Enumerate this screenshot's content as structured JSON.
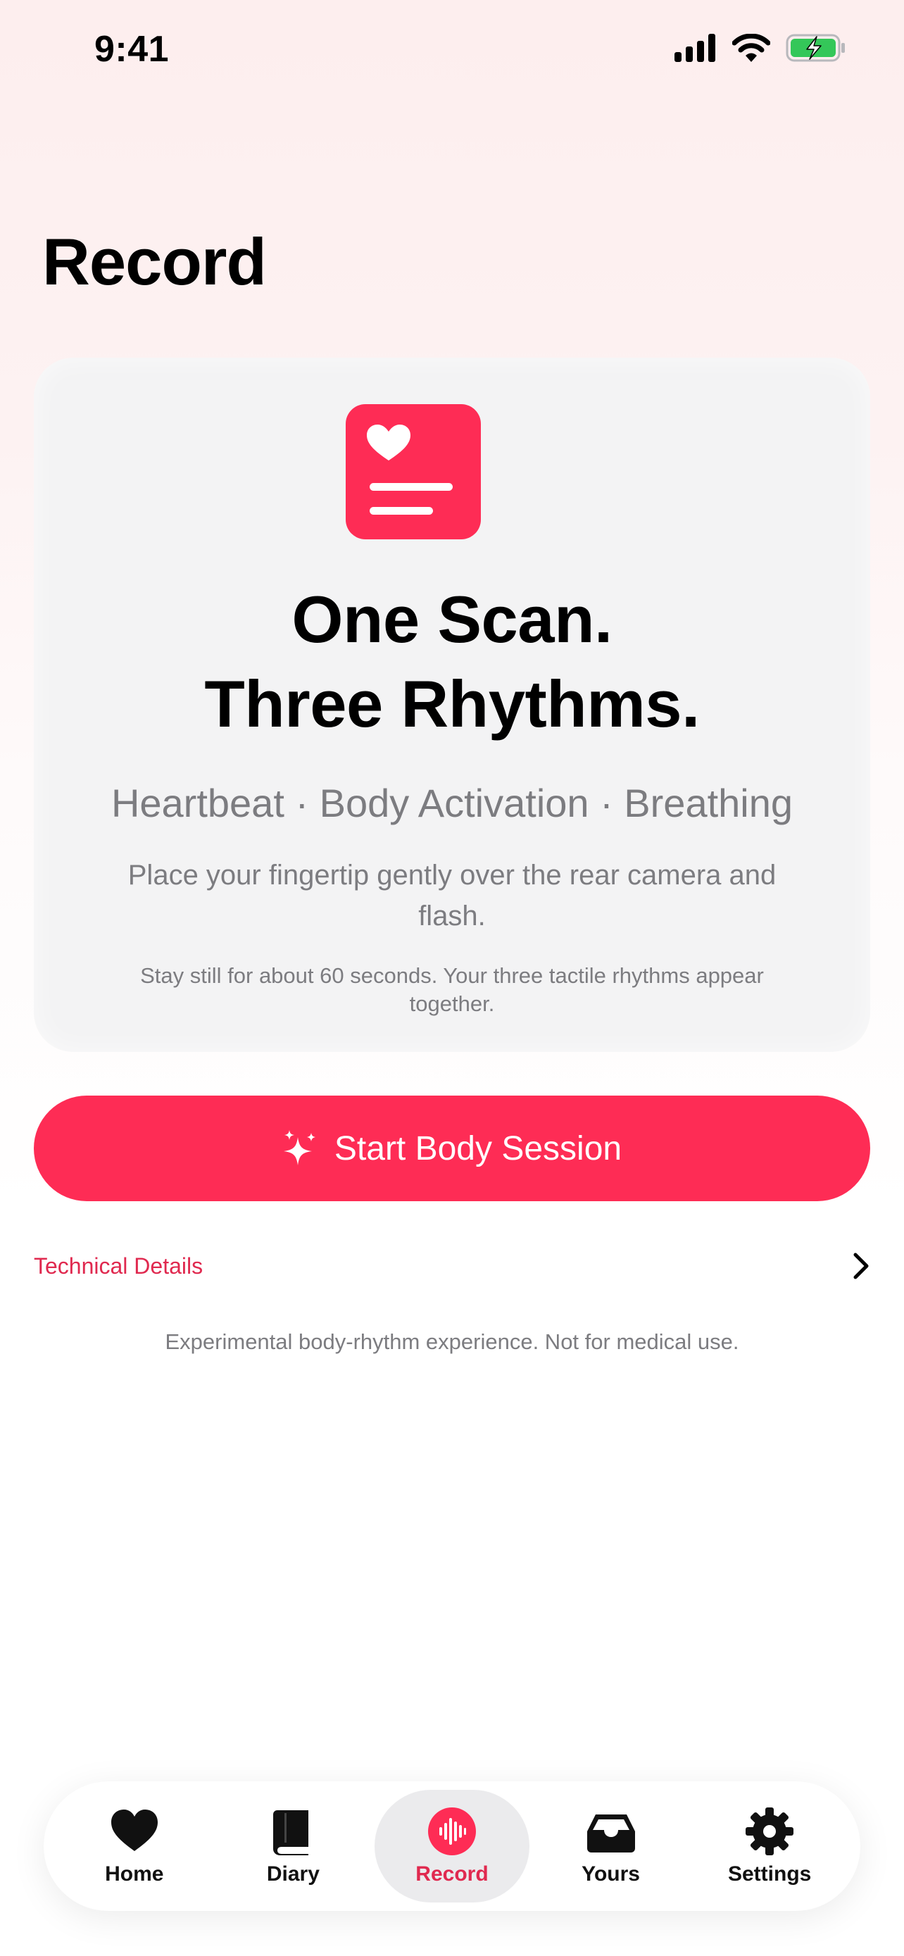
{
  "status_bar": {
    "time": "9:41"
  },
  "page": {
    "title": "Record"
  },
  "hero": {
    "icon": "heart-document-icon",
    "headline_line1": "One Scan.",
    "headline_line2": "Three Rhythms.",
    "rhythms": "Heartbeat · Body Activation · Breathing",
    "instruction": "Place your fingertip gently over the rear camera and flash.",
    "note": "Stay still for about 60 seconds. Your three tactile rhythms appear together."
  },
  "start_button": {
    "label": "Start Body Session",
    "icon": "sparkles-icon"
  },
  "technical_details": {
    "label": "Technical Details",
    "icon": "chevron-right-icon"
  },
  "disclaimer": "Experimental body-rhythm experience. Not for medical use.",
  "tabs": [
    {
      "label": "Home",
      "icon": "heart-icon",
      "active": false
    },
    {
      "label": "Diary",
      "icon": "book-icon",
      "active": false
    },
    {
      "label": "Record",
      "icon": "waveform-icon",
      "active": true
    },
    {
      "label": "Yours",
      "icon": "tray-icon",
      "active": false
    },
    {
      "label": "Settings",
      "icon": "gear-icon",
      "active": false
    }
  ],
  "colors": {
    "accent": "#fe2c55",
    "accent_text": "#e0294f",
    "secondary_text": "#7c7c80",
    "card_background": "#f3f3f4",
    "battery_fill": "#34c759"
  }
}
